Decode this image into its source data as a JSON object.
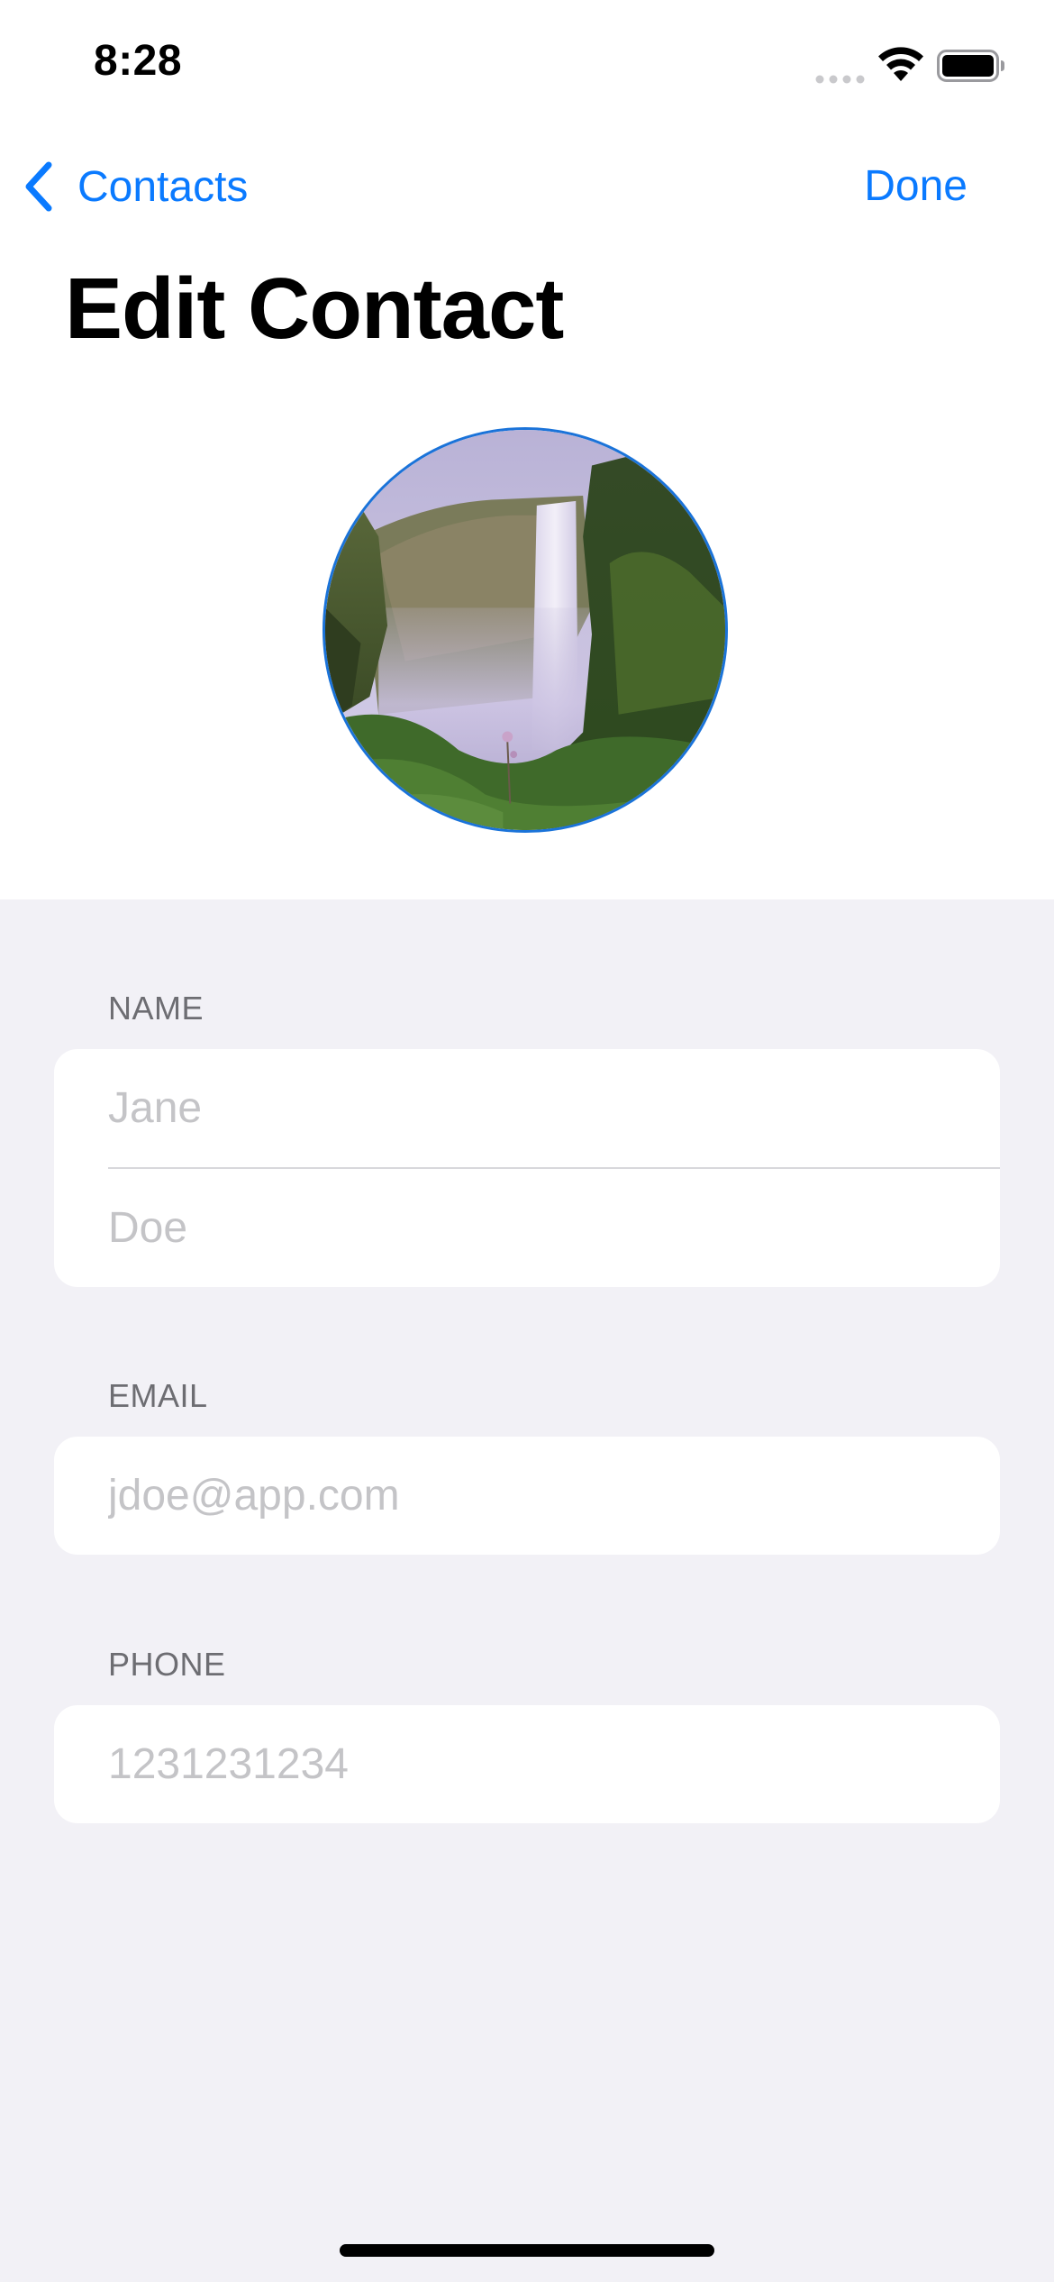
{
  "status_bar": {
    "time": "8:28",
    "icons": [
      "signal-icon",
      "wifi-icon",
      "battery-icon"
    ]
  },
  "nav": {
    "back_label": "Contacts",
    "back_icon": "chevron-left-icon",
    "done_label": "Done"
  },
  "title": "Edit Contact",
  "avatar": {
    "image": "waterfall photo"
  },
  "sections": {
    "name": {
      "header": "NAME",
      "first_placeholder": "Jane",
      "last_placeholder": "Doe"
    },
    "email": {
      "header": "EMAIL",
      "placeholder": "jdoe@app.com"
    },
    "phone": {
      "header": "PHONE",
      "placeholder": "1231231234"
    }
  },
  "colors": {
    "accent": "#0a7aff",
    "grouped_background": "#f2f1f6",
    "placeholder": "#c4c4c7",
    "section_header": "#6d6d72"
  }
}
